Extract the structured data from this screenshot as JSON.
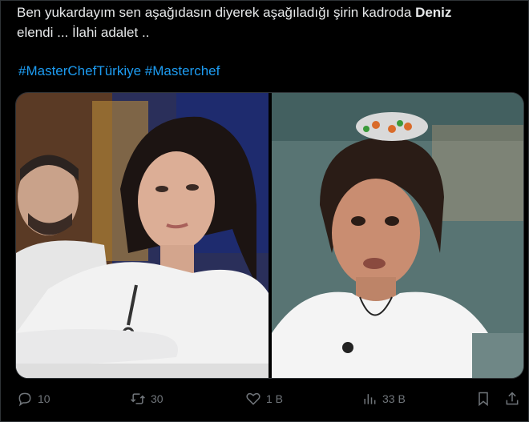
{
  "tweet": {
    "text_line1_a": "Ben yukardayım sen aşağıdasın diyerek aşağıladığı şirin kadroda ",
    "text_line1_bold": "Deniz",
    "text_line2": "elendi ... İlahi adalet ..",
    "hashtags": [
      "#MasterChefTürkiye",
      "#Masterchef"
    ]
  },
  "actions": {
    "replies": "10",
    "retweets": "30",
    "likes": "1 B",
    "views": "33 B"
  },
  "colors": {
    "link": "#1d9bf0",
    "text": "#e7e9ea",
    "muted": "#71767b",
    "bg": "#000000"
  }
}
